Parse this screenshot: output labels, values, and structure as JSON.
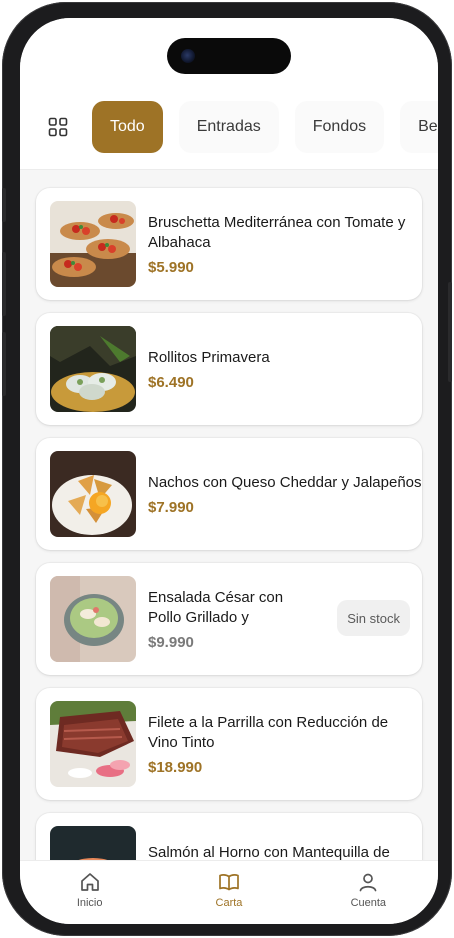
{
  "categories": {
    "grid_icon": "grid-icon",
    "items": [
      {
        "label": "Todo",
        "active": true
      },
      {
        "label": "Entradas",
        "active": false
      },
      {
        "label": "Fondos",
        "active": false
      },
      {
        "label": "Bel",
        "active": false
      }
    ]
  },
  "products": [
    {
      "name": "Bruschetta Mediterránea con Tomate y Albahaca",
      "price": "$5.990",
      "in_stock": true
    },
    {
      "name": "Rollitos Primavera",
      "price": "$6.490",
      "in_stock": true
    },
    {
      "name": "Nachos con Queso Cheddar y Jalapeños",
      "price": "$7.990",
      "in_stock": true
    },
    {
      "name": "Ensalada César con Pollo Grillado y",
      "price": "$9.990",
      "in_stock": false,
      "badge": "Sin stock"
    },
    {
      "name": "Filete a la Parrilla con Reducción de Vino Tinto",
      "price": "$18.990",
      "in_stock": true
    },
    {
      "name": "Salmón al Horno con Mantequilla de Limón y Hierbas Aromáticas Frescas",
      "price": "",
      "in_stock": true
    }
  ],
  "tabbar": {
    "items": [
      {
        "label": "Inicio",
        "icon": "home-icon",
        "active": false
      },
      {
        "label": "Carta",
        "icon": "book-icon",
        "active": true
      },
      {
        "label": "Cuenta",
        "icon": "user-icon",
        "active": false
      }
    ]
  },
  "colors": {
    "accent": "#9e7326",
    "background": "#f6f6f6",
    "card": "#ffffff"
  }
}
